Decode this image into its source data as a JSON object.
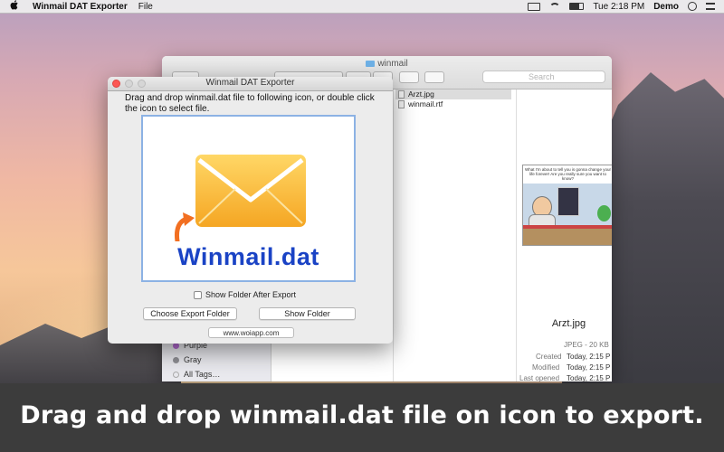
{
  "menubar": {
    "app_name": "Winmail DAT Exporter",
    "file_menu": "File",
    "datetime": "Tue 2:18 PM",
    "user": "Demo",
    "icons": [
      "apple-icon",
      "airplay-icon",
      "wifi-icon",
      "battery-icon",
      "spotlight-icon",
      "notification-icon"
    ]
  },
  "finder": {
    "title": "winmail",
    "search_placeholder": "Search",
    "files": [
      {
        "name": "Arzt.jpg",
        "selected": true
      },
      {
        "name": "winmail.rtf",
        "selected": false
      }
    ],
    "tags": [
      {
        "name": "Purple",
        "color": "#b36ad2"
      },
      {
        "name": "Gray",
        "color": "#8e8e93"
      },
      {
        "name": "All Tags…",
        "color": ""
      }
    ],
    "preview": {
      "bubble_text": "What I'm about to tell you is gonna change your life forever! Are you really sure you want to know?",
      "filename": "Arzt.jpg",
      "kind": "JPEG - 20 KB",
      "rows": [
        {
          "label": "Created",
          "value": "Today, 2:15 P"
        },
        {
          "label": "Modified",
          "value": "Today, 2:15 P"
        },
        {
          "label": "Last opened",
          "value": "Today, 2:15 P"
        }
      ]
    }
  },
  "exporter": {
    "title": "Winmail DAT Exporter",
    "instructions": "Drag and drop winmail.dat file to following icon, or double click the icon to select file.",
    "drop_label": "Winmail.dat",
    "checkbox_label": "Show Folder After Export",
    "checkbox_checked": false,
    "choose_button": "Choose Export Folder",
    "show_button": "Show Folder",
    "link": "www.woiapp.com"
  },
  "banner": {
    "caption": "Drag and drop winmail.dat file on icon to export."
  },
  "colors": {
    "accent_blue": "#1a43c5",
    "envelope_yellow": "#f7b82f",
    "arrow_orange": "#f26f21",
    "drop_border": "#8cb2e4"
  }
}
